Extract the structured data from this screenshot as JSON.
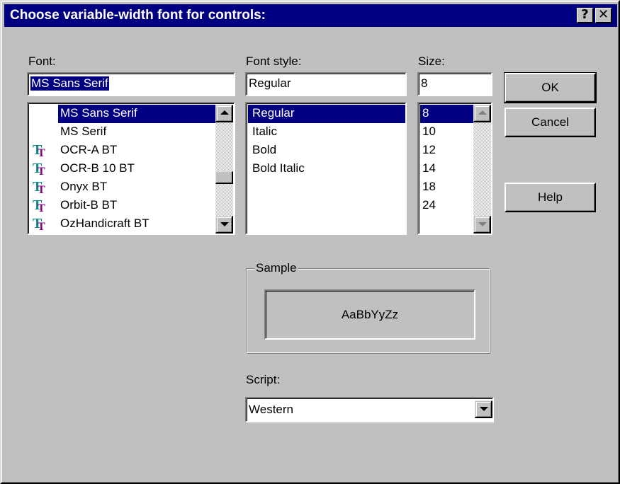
{
  "title": "Choose variable-width font for controls:",
  "title_buttons": {
    "help": "?",
    "close": "✕"
  },
  "font": {
    "label": "Font:",
    "value": "MS Sans Serif",
    "items": [
      {
        "label": "MS Sans Serif",
        "icon": "none",
        "selected": true
      },
      {
        "label": "MS Serif",
        "icon": "none",
        "selected": false
      },
      {
        "label": "OCR-A BT",
        "icon": "truetype-icon",
        "selected": false
      },
      {
        "label": "OCR-B 10 BT",
        "icon": "truetype-icon",
        "selected": false
      },
      {
        "label": "Onyx BT",
        "icon": "truetype-icon",
        "selected": false
      },
      {
        "label": "Orbit-B BT",
        "icon": "truetype-icon",
        "selected": false
      },
      {
        "label": "OzHandicraft BT",
        "icon": "truetype-icon",
        "selected": false
      }
    ]
  },
  "font_style": {
    "label": "Font style:",
    "value": "Regular",
    "items": [
      "Regular",
      "Italic",
      "Bold",
      "Bold Italic"
    ],
    "selected_index": 0
  },
  "size": {
    "label": "Size:",
    "value": "8",
    "items": [
      "8",
      "10",
      "12",
      "14",
      "18",
      "24"
    ],
    "selected_index": 0
  },
  "buttons": {
    "ok": "OK",
    "cancel": "Cancel",
    "help": "Help"
  },
  "sample": {
    "label": "Sample",
    "text": "AaBbYyZz"
  },
  "script": {
    "label": "Script:",
    "value": "Western"
  },
  "colors": {
    "titlebar": "#000080",
    "face": "#c0c0c0",
    "selection": "#000080",
    "tt_icon_teal": "#0d8a8a",
    "tt_icon_purple": "#800080"
  },
  "tt_glyph": "T"
}
